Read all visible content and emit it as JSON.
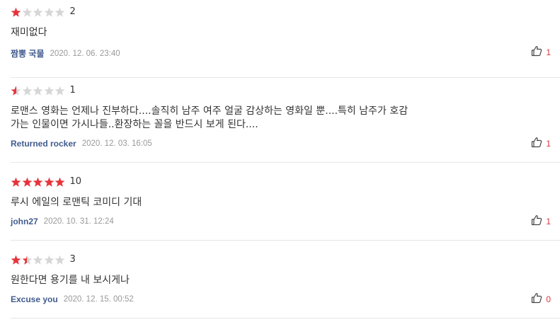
{
  "colors": {
    "star_on": "#e8333b",
    "star_off": "#d6d6d6",
    "author": "#415b8e",
    "date": "#999999",
    "like_count": "#d9363e"
  },
  "reviews": [
    {
      "rating_fraction": 0.2,
      "score": "2",
      "content": "재미없다",
      "author": "짬뽕 국물",
      "date": "2020. 12. 06. 23:40",
      "likes": "1"
    },
    {
      "rating_fraction": 0.1,
      "score": "1",
      "content": "로맨스 영화는 언제나 진부하다....솔직히 남주 여주 얼굴 감상하는 영화일 뿐....특히 남주가 호감\n가는 인물이면 가시나들..환장하는 꼴을 반드시 보게 된다....",
      "author": "Returned rocker",
      "date": "2020. 12. 03. 16:05",
      "likes": "1"
    },
    {
      "rating_fraction": 1.0,
      "score": "10",
      "content": "루시 에일의 로맨틱 코미디 기대",
      "author": "john27",
      "date": "2020. 10. 31. 12:24",
      "likes": "1"
    },
    {
      "rating_fraction": 0.3,
      "score": "3",
      "content": "원한다면 용기를 내 보시게나",
      "author": "Excuse you",
      "date": "2020. 12. 15. 00:52",
      "likes": "0"
    }
  ]
}
